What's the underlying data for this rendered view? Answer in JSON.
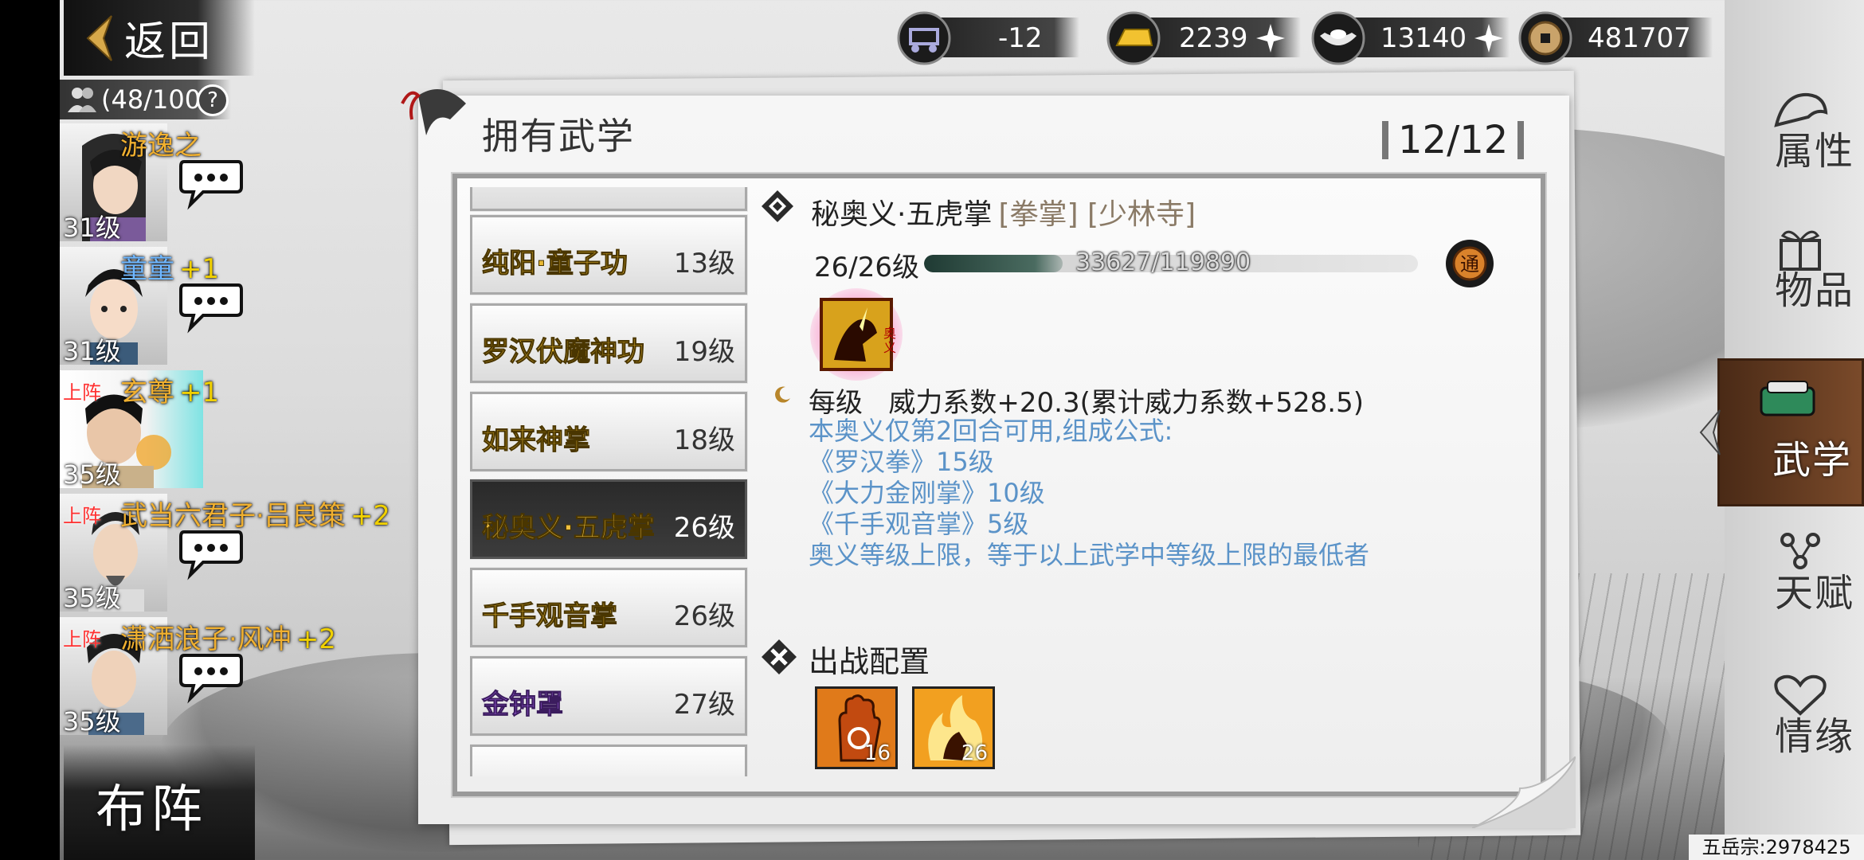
{
  "top_left": {
    "back_label": "返回",
    "capacity_text": "(48/100"
  },
  "characters": [
    {
      "name": "游逸之",
      "plus": "",
      "level": "31级",
      "onstage": ""
    },
    {
      "name": "童童",
      "plus": "+1",
      "level": "31级",
      "onstage": ""
    },
    {
      "name": "玄尊",
      "plus": "+1",
      "level": "35级",
      "onstage": "上阵"
    },
    {
      "name": "武当六君子·吕良策",
      "plus": "+2",
      "level": "35级",
      "onstage": "上阵"
    },
    {
      "name": "潇洒浪子·风冲",
      "plus": "+2",
      "level": "35级",
      "onstage": "上阵"
    }
  ],
  "formation_label": "布阵",
  "currencies": [
    {
      "icon": "cart-icon",
      "value": "-12"
    },
    {
      "icon": "gold-bar-icon",
      "value": "2239"
    },
    {
      "icon": "silver-ingot-icon",
      "value": "13140"
    },
    {
      "icon": "coin-icon",
      "value": "481707"
    }
  ],
  "right_tabs": [
    "属性",
    "物品",
    "武学",
    "天赋",
    "情缘"
  ],
  "active_tab": "武学",
  "panel": {
    "title": "拥有武学",
    "count": "12/12"
  },
  "skill_list": [
    {
      "name": "纯阳·童子功",
      "level": "13级"
    },
    {
      "name": "罗汉伏魔神功",
      "level": "19级"
    },
    {
      "name": "如来神掌",
      "level": "18级"
    },
    {
      "name": "秘奥义·五虎掌",
      "level": "26级"
    },
    {
      "name": "千手观音掌",
      "level": "26级"
    },
    {
      "name": "金钟罩",
      "level": "27级"
    }
  ],
  "detail": {
    "name": "秘奥义·五虎掌",
    "tags": "[拳掌] [少林寺]",
    "level": "26/26级",
    "xp": "33627/119890",
    "xp_fraction": 0.28,
    "tong_label": "通",
    "icon_badge": "奥义",
    "per_level": "每级   威力系数+20.3(累计威力系数+528.5)",
    "desc_lines": [
      "本奥义仅第2回合可用,组成公式:",
      "《罗汉拳》15级",
      "《大力金刚掌》10级",
      "《千手观音掌》5级",
      "奥义等级上限，等于以上武学中等级上限的最低者"
    ]
  },
  "deploy": {
    "title": "出战配置",
    "slots": [
      {
        "icon": "palm-icon",
        "level": "16"
      },
      {
        "icon": "fire-fist-icon",
        "level": "26"
      }
    ]
  },
  "guild_text": "五岳宗:2978425",
  "colors": {
    "gold_name": "#e8b832",
    "purple_name": "#b46cff",
    "desc_blue": "#5b93c8",
    "onstage_red": "#ff3030"
  }
}
